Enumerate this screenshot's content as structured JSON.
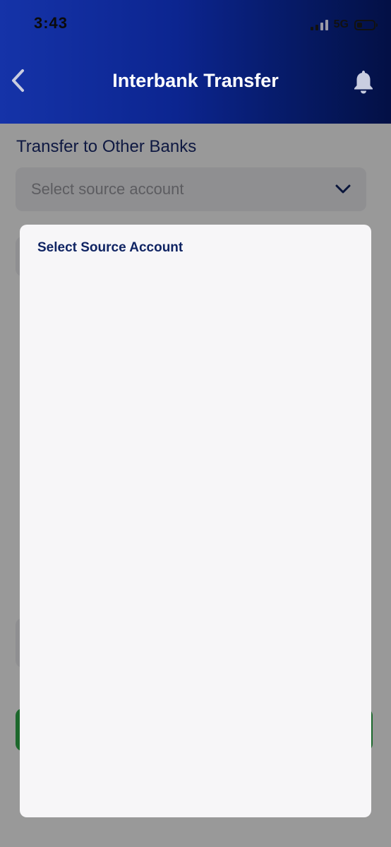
{
  "status_bar": {
    "time": "3:43",
    "network": "5G",
    "signal_bars_active": 2,
    "signal_bars_total": 4,
    "battery_level_percent": 30
  },
  "header": {
    "title": "Interbank Transfer",
    "back_icon": "chevron-left-icon",
    "bell_icon": "bell-icon"
  },
  "form": {
    "section_title": "Transfer to Other Banks",
    "source_account_placeholder": "Select source account",
    "dropdown_icon": "chevron-down-icon"
  },
  "modal": {
    "title": "Select Source Account"
  },
  "colors": {
    "header_start": "#1533a8",
    "header_end": "#031045",
    "primary_text": "#102463",
    "accent_green": "#2fae4a"
  }
}
